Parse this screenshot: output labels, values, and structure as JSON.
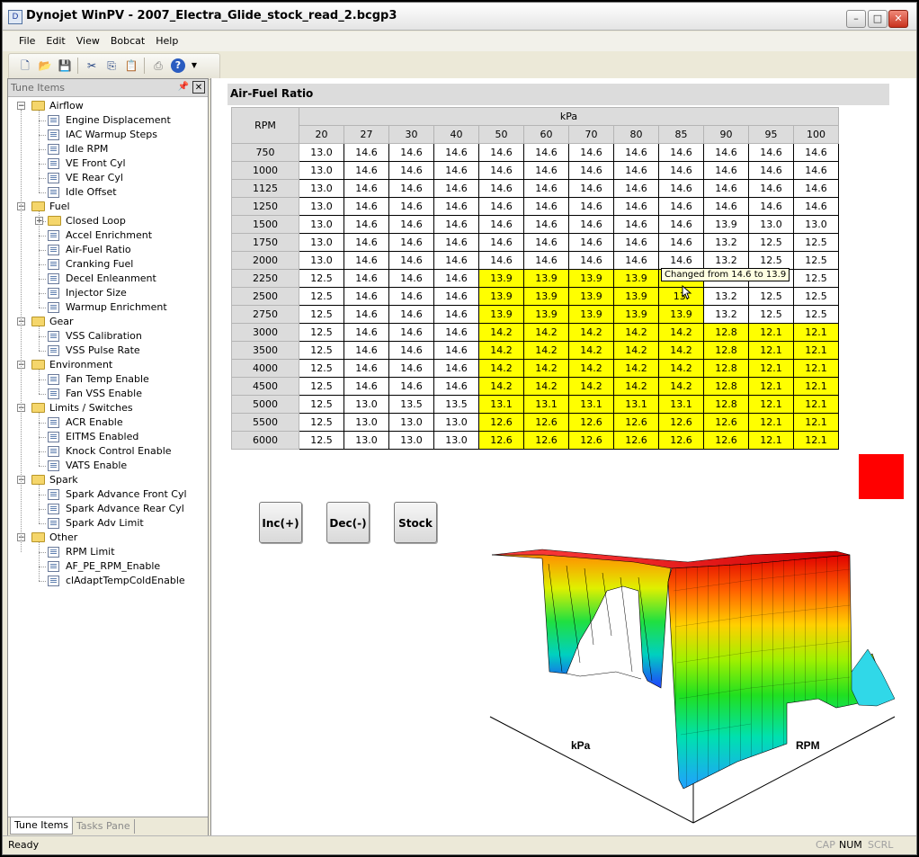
{
  "window": {
    "title": "Dynojet WinPV  - 2007_Electra_Glide_stock_read_2.bcgp3"
  },
  "menu": [
    "File",
    "Edit",
    "View",
    "Bobcat",
    "Help"
  ],
  "left_pane": {
    "header": "Tune Items",
    "tabs": {
      "active": "Tune Items",
      "inactive": "Tasks Pane"
    },
    "groups": [
      {
        "label": "Airflow",
        "items": [
          "Engine Displacement",
          "IAC Warmup Steps",
          "Idle RPM",
          "VE Front Cyl",
          "VE Rear Cyl",
          "Idle Offset"
        ]
      },
      {
        "label": "Fuel",
        "items": [
          "Closed Loop",
          "Accel Enrichment",
          "Air-Fuel Ratio",
          "Cranking Fuel",
          "Decel Enleanment",
          "Injector Size",
          "Warmup Enrichment"
        ]
      },
      {
        "label": "Gear",
        "items": [
          "VSS Calibration",
          "VSS Pulse Rate"
        ]
      },
      {
        "label": "Environment",
        "items": [
          "Fan Temp Enable",
          "Fan VSS Enable"
        ]
      },
      {
        "label": "Limits / Switches",
        "items": [
          "ACR Enable",
          "EITMS Enabled",
          "Knock Control Enable",
          "VATS Enable"
        ]
      },
      {
        "label": "Spark",
        "items": [
          "Spark Advance Front Cyl",
          "Spark Advance Rear Cyl",
          "Spark Adv Limit"
        ]
      },
      {
        "label": "Other",
        "items": [
          "RPM Limit",
          "AF_PE_RPM_Enable",
          "clAdaptTempColdEnable"
        ]
      }
    ]
  },
  "afr": {
    "title": "Air-Fuel Ratio",
    "row_header": "RPM",
    "col_group": "kPa",
    "kpa": [
      "20",
      "27",
      "30",
      "40",
      "50",
      "60",
      "70",
      "80",
      "85",
      "90",
      "95",
      "100"
    ],
    "rpm": [
      "750",
      "1000",
      "1125",
      "1250",
      "1500",
      "1750",
      "2000",
      "2250",
      "2500",
      "2750",
      "3000",
      "3500",
      "4000",
      "4500",
      "5000",
      "5500",
      "6000"
    ],
    "values": [
      [
        "13.0",
        "14.6",
        "14.6",
        "14.6",
        "14.6",
        "14.6",
        "14.6",
        "14.6",
        "14.6",
        "14.6",
        "14.6",
        "14.6"
      ],
      [
        "13.0",
        "14.6",
        "14.6",
        "14.6",
        "14.6",
        "14.6",
        "14.6",
        "14.6",
        "14.6",
        "14.6",
        "14.6",
        "14.6"
      ],
      [
        "13.0",
        "14.6",
        "14.6",
        "14.6",
        "14.6",
        "14.6",
        "14.6",
        "14.6",
        "14.6",
        "14.6",
        "14.6",
        "14.6"
      ],
      [
        "13.0",
        "14.6",
        "14.6",
        "14.6",
        "14.6",
        "14.6",
        "14.6",
        "14.6",
        "14.6",
        "14.6",
        "14.6",
        "14.6"
      ],
      [
        "13.0",
        "14.6",
        "14.6",
        "14.6",
        "14.6",
        "14.6",
        "14.6",
        "14.6",
        "14.6",
        "13.9",
        "13.0",
        "13.0"
      ],
      [
        "13.0",
        "14.6",
        "14.6",
        "14.6",
        "14.6",
        "14.6",
        "14.6",
        "14.6",
        "14.6",
        "13.2",
        "12.5",
        "12.5"
      ],
      [
        "13.0",
        "14.6",
        "14.6",
        "14.6",
        "14.6",
        "14.6",
        "14.6",
        "14.6",
        "14.6",
        "13.2",
        "12.5",
        "12.5"
      ],
      [
        "12.5",
        "14.6",
        "14.6",
        "14.6",
        "13.9",
        "13.9",
        "13.9",
        "13.9",
        "",
        "",
        "",
        "12.5"
      ],
      [
        "12.5",
        "14.6",
        "14.6",
        "14.6",
        "13.9",
        "13.9",
        "13.9",
        "13.9",
        "13.",
        "13.2",
        "12.5",
        "12.5"
      ],
      [
        "12.5",
        "14.6",
        "14.6",
        "14.6",
        "13.9",
        "13.9",
        "13.9",
        "13.9",
        "13.9",
        "13.2",
        "12.5",
        "12.5"
      ],
      [
        "12.5",
        "14.6",
        "14.6",
        "14.6",
        "14.2",
        "14.2",
        "14.2",
        "14.2",
        "14.2",
        "12.8",
        "12.1",
        "12.1"
      ],
      [
        "12.5",
        "14.6",
        "14.6",
        "14.6",
        "14.2",
        "14.2",
        "14.2",
        "14.2",
        "14.2",
        "12.8",
        "12.1",
        "12.1"
      ],
      [
        "12.5",
        "14.6",
        "14.6",
        "14.6",
        "14.2",
        "14.2",
        "14.2",
        "14.2",
        "14.2",
        "12.8",
        "12.1",
        "12.1"
      ],
      [
        "12.5",
        "14.6",
        "14.6",
        "14.6",
        "14.2",
        "14.2",
        "14.2",
        "14.2",
        "14.2",
        "12.8",
        "12.1",
        "12.1"
      ],
      [
        "12.5",
        "13.0",
        "13.5",
        "13.5",
        "13.1",
        "13.1",
        "13.1",
        "13.1",
        "13.1",
        "12.8",
        "12.1",
        "12.1"
      ],
      [
        "12.5",
        "13.0",
        "13.0",
        "13.0",
        "12.6",
        "12.6",
        "12.6",
        "12.6",
        "12.6",
        "12.6",
        "12.1",
        "12.1"
      ],
      [
        "12.5",
        "13.0",
        "13.0",
        "13.0",
        "12.6",
        "12.6",
        "12.6",
        "12.6",
        "12.6",
        "12.6",
        "12.1",
        "12.1"
      ]
    ],
    "highlight": [
      [
        0,
        0,
        0,
        0,
        0,
        0,
        0,
        0,
        0,
        0,
        0,
        0
      ],
      [
        0,
        0,
        0,
        0,
        0,
        0,
        0,
        0,
        0,
        0,
        0,
        0
      ],
      [
        0,
        0,
        0,
        0,
        0,
        0,
        0,
        0,
        0,
        0,
        0,
        0
      ],
      [
        0,
        0,
        0,
        0,
        0,
        0,
        0,
        0,
        0,
        0,
        0,
        0
      ],
      [
        0,
        0,
        0,
        0,
        0,
        0,
        0,
        0,
        0,
        0,
        0,
        0
      ],
      [
        0,
        0,
        0,
        0,
        0,
        0,
        0,
        0,
        0,
        0,
        0,
        0
      ],
      [
        0,
        0,
        0,
        0,
        0,
        0,
        0,
        0,
        0,
        0,
        0,
        0
      ],
      [
        0,
        0,
        0,
        0,
        1,
        1,
        1,
        1,
        1,
        0,
        0,
        0
      ],
      [
        0,
        0,
        0,
        0,
        1,
        1,
        1,
        1,
        1,
        0,
        0,
        0
      ],
      [
        0,
        0,
        0,
        0,
        1,
        1,
        1,
        1,
        1,
        0,
        0,
        0
      ],
      [
        0,
        0,
        0,
        0,
        1,
        1,
        1,
        1,
        1,
        1,
        1,
        1
      ],
      [
        0,
        0,
        0,
        0,
        1,
        1,
        1,
        1,
        1,
        1,
        1,
        1
      ],
      [
        0,
        0,
        0,
        0,
        1,
        1,
        1,
        1,
        1,
        1,
        1,
        1
      ],
      [
        0,
        0,
        0,
        0,
        1,
        1,
        1,
        1,
        1,
        1,
        1,
        1
      ],
      [
        0,
        0,
        0,
        0,
        1,
        1,
        1,
        1,
        1,
        1,
        1,
        1
      ],
      [
        0,
        0,
        0,
        0,
        1,
        1,
        1,
        1,
        1,
        1,
        1,
        1
      ],
      [
        0,
        0,
        0,
        0,
        1,
        1,
        1,
        1,
        1,
        1,
        1,
        1
      ]
    ],
    "highlight_color": "#ffff00",
    "tooltip": "Changed from 14.6 to 13.9"
  },
  "buttons": {
    "inc": "Inc(+)",
    "dec": "Dec(-)",
    "stock": "Stock"
  },
  "indicator_color": "#ff0000",
  "plot": {
    "x_label": "kPa",
    "y_label": "RPM"
  },
  "status": {
    "text": "Ready",
    "cap": "CAP",
    "num": "NUM",
    "scrl": "SCRL"
  }
}
